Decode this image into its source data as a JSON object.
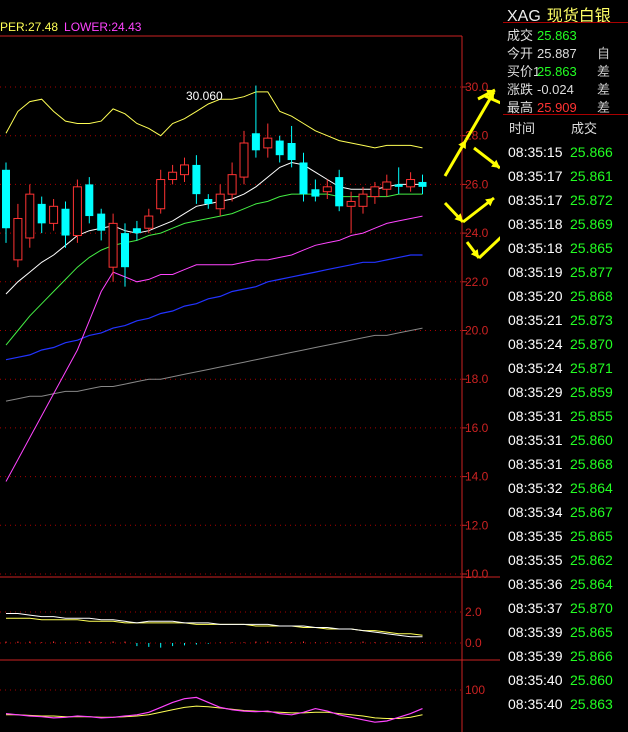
{
  "legend": {
    "upper": "PER:27.48",
    "lower": "LOWER:24.43"
  },
  "peak_label": "30.060",
  "quote": {
    "symbol": "XAG",
    "name": "现货白银",
    "rows": [
      {
        "label": "成交",
        "value": "25.863",
        "color": "#22ff22",
        "extra": ""
      },
      {
        "label": "今开",
        "value": "25.887",
        "color": "#dddddd",
        "extra": "自"
      },
      {
        "label": "买价1",
        "value": "25.863",
        "color": "#22ff22",
        "extra": "差"
      },
      {
        "label": "涨跌",
        "value": "-0.024",
        "color": "#dddddd",
        "extra": "差"
      },
      {
        "label": "最高",
        "value": "25.909",
        "color": "#ff3333",
        "extra": "差"
      }
    ]
  },
  "ticks": {
    "header_time": "时间",
    "header_price": "成交",
    "rows": [
      {
        "time": "08:35:15",
        "price": "25.866"
      },
      {
        "time": "08:35:17",
        "price": "25.861"
      },
      {
        "time": "08:35:17",
        "price": "25.872"
      },
      {
        "time": "08:35:18",
        "price": "25.869"
      },
      {
        "time": "08:35:18",
        "price": "25.865"
      },
      {
        "time": "08:35:19",
        "price": "25.877"
      },
      {
        "time": "08:35:20",
        "price": "25.868"
      },
      {
        "time": "08:35:21",
        "price": "25.873"
      },
      {
        "time": "08:35:24",
        "price": "25.870"
      },
      {
        "time": "08:35:24",
        "price": "25.871"
      },
      {
        "time": "08:35:29",
        "price": "25.859"
      },
      {
        "time": "08:35:31",
        "price": "25.855"
      },
      {
        "time": "08:35:31",
        "price": "25.860"
      },
      {
        "time": "08:35:31",
        "price": "25.868"
      },
      {
        "time": "08:35:32",
        "price": "25.864"
      },
      {
        "time": "08:35:34",
        "price": "25.867"
      },
      {
        "time": "08:35:35",
        "price": "25.865"
      },
      {
        "time": "08:35:35",
        "price": "25.862"
      },
      {
        "time": "08:35:36",
        "price": "25.864"
      },
      {
        "time": "08:35:37",
        "price": "25.870"
      },
      {
        "time": "08:35:39",
        "price": "25.865"
      },
      {
        "time": "08:35:39",
        "price": "25.866"
      },
      {
        "time": "08:35:40",
        "price": "25.860"
      },
      {
        "time": "08:35:40",
        "price": "25.863"
      }
    ]
  },
  "chart_data": {
    "type": "line",
    "price_axis": {
      "labels": [
        "30.0",
        "28.0",
        "26.0",
        "24.0",
        "22.0",
        "20.0",
        "18.0",
        "16.0",
        "14.0",
        "12.0",
        "10.0"
      ],
      "ylim": [
        10,
        30
      ]
    },
    "macd_axis": {
      "labels": [
        "2.0",
        "0.0"
      ]
    },
    "osc_axis": {
      "labels": [
        "100"
      ]
    },
    "colors": {
      "grid": "#aa0000",
      "axis": "#cc2222",
      "up": "#ff3333",
      "down": "#00ffff",
      "boll_upper": "#ffff55",
      "boll_lower": "#ff44ff",
      "mid": "#ffffff",
      "ma_green": "#44ee44",
      "ma_blue": "#2233ff",
      "ma_gray": "#888888",
      "arrow": "#ffff00"
    },
    "candles": [
      {
        "o": 26.6,
        "c": 24.2,
        "h": 26.9,
        "l": 23.6
      },
      {
        "o": 22.9,
        "c": 24.6,
        "h": 25.2,
        "l": 22.6
      },
      {
        "o": 23.8,
        "c": 25.6,
        "h": 26.0,
        "l": 23.4
      },
      {
        "o": 25.2,
        "c": 24.4,
        "h": 25.5,
        "l": 24.0
      },
      {
        "o": 24.4,
        "c": 25.1,
        "h": 25.4,
        "l": 24.1
      },
      {
        "o": 25.0,
        "c": 23.9,
        "h": 25.3,
        "l": 23.4
      },
      {
        "o": 23.9,
        "c": 25.9,
        "h": 26.2,
        "l": 23.6
      },
      {
        "o": 26.0,
        "c": 24.7,
        "h": 26.3,
        "l": 24.4
      },
      {
        "o": 24.8,
        "c": 24.1,
        "h": 25.0,
        "l": 23.7
      },
      {
        "o": 22.6,
        "c": 24.4,
        "h": 24.8,
        "l": 22.0
      },
      {
        "o": 24.0,
        "c": 22.6,
        "h": 24.4,
        "l": 21.8
      },
      {
        "o": 24.2,
        "c": 24.0,
        "h": 24.5,
        "l": 23.7
      },
      {
        "o": 24.2,
        "c": 24.7,
        "h": 25.0,
        "l": 24.0
      },
      {
        "o": 25.0,
        "c": 26.2,
        "h": 26.6,
        "l": 24.8
      },
      {
        "o": 26.2,
        "c": 26.5,
        "h": 26.8,
        "l": 26.0
      },
      {
        "o": 26.4,
        "c": 26.8,
        "h": 27.1,
        "l": 26.1
      },
      {
        "o": 26.8,
        "c": 25.6,
        "h": 27.2,
        "l": 25.2
      },
      {
        "o": 25.4,
        "c": 25.2,
        "h": 25.6,
        "l": 25.0
      },
      {
        "o": 25.0,
        "c": 25.6,
        "h": 26.0,
        "l": 24.7
      },
      {
        "o": 25.6,
        "c": 26.4,
        "h": 26.9,
        "l": 25.3
      },
      {
        "o": 26.3,
        "c": 27.7,
        "h": 28.2,
        "l": 26.0
      },
      {
        "o": 28.1,
        "c": 27.4,
        "h": 30.06,
        "l": 27.1
      },
      {
        "o": 27.5,
        "c": 27.9,
        "h": 28.5,
        "l": 27.1
      },
      {
        "o": 27.8,
        "c": 27.2,
        "h": 28.0,
        "l": 26.9
      },
      {
        "o": 27.7,
        "c": 27.0,
        "h": 28.4,
        "l": 26.7
      },
      {
        "o": 26.9,
        "c": 25.6,
        "h": 27.3,
        "l": 25.3
      },
      {
        "o": 25.8,
        "c": 25.5,
        "h": 26.2,
        "l": 25.3
      },
      {
        "o": 25.7,
        "c": 25.9,
        "h": 26.2,
        "l": 25.4
      },
      {
        "o": 26.3,
        "c": 25.1,
        "h": 26.6,
        "l": 24.9
      },
      {
        "o": 25.1,
        "c": 25.3,
        "h": 25.7,
        "l": 24.0
      },
      {
        "o": 25.1,
        "c": 25.6,
        "h": 25.9,
        "l": 24.8
      },
      {
        "o": 25.5,
        "c": 25.9,
        "h": 26.1,
        "l": 25.2
      },
      {
        "o": 25.8,
        "c": 26.1,
        "h": 26.4,
        "l": 25.5
      },
      {
        "o": 26.0,
        "c": 25.9,
        "h": 26.7,
        "l": 25.6
      },
      {
        "o": 25.9,
        "c": 26.2,
        "h": 26.5,
        "l": 25.7
      },
      {
        "o": 26.1,
        "c": 25.9,
        "h": 26.4,
        "l": 25.6
      }
    ],
    "lines": {
      "boll_upper": [
        28.1,
        29.0,
        29.4,
        29.5,
        29.0,
        28.6,
        28.5,
        28.5,
        28.6,
        29.1,
        28.9,
        28.5,
        28.3,
        28.0,
        28.5,
        28.7,
        29.0,
        29.3,
        29.5,
        29.5,
        29.6,
        29.8,
        29.8,
        29.0,
        28.8,
        28.5,
        28.2,
        28.0,
        27.8,
        27.7,
        27.6,
        27.5,
        27.6,
        27.6,
        27.6,
        27.5
      ],
      "boll_lower": [
        13.8,
        14.7,
        15.6,
        16.5,
        17.4,
        18.3,
        19.2,
        20.4,
        21.6,
        22.4,
        22.2,
        22.0,
        22.1,
        22.3,
        22.3,
        22.5,
        22.7,
        22.7,
        22.7,
        22.7,
        22.8,
        22.9,
        22.9,
        23.0,
        23.1,
        23.3,
        23.5,
        23.6,
        23.7,
        23.9,
        24.0,
        24.2,
        24.4,
        24.5,
        24.6,
        24.7
      ],
      "mid": [
        21.5,
        22.0,
        22.4,
        22.8,
        23.1,
        23.5,
        23.9,
        24.1,
        24.2,
        24.3,
        24.1,
        24.0,
        24.1,
        24.3,
        24.5,
        24.8,
        25.1,
        25.2,
        25.3,
        25.4,
        25.6,
        25.9,
        26.3,
        26.7,
        26.9,
        26.8,
        26.5,
        26.2,
        25.9,
        25.8,
        25.8,
        25.8,
        25.9,
        26.0,
        26.0,
        26.0
      ],
      "ma_green": [
        19.4,
        20.0,
        20.6,
        21.1,
        21.6,
        22.1,
        22.6,
        23.0,
        23.3,
        23.5,
        23.6,
        23.7,
        23.9,
        24.0,
        24.2,
        24.4,
        24.5,
        24.6,
        24.7,
        24.8,
        25.0,
        25.2,
        25.3,
        25.5,
        25.6,
        25.6,
        25.6,
        25.6,
        25.5,
        25.5,
        25.5,
        25.5,
        25.5,
        25.6,
        25.6,
        25.6
      ],
      "ma_blue": [
        18.8,
        18.9,
        19.0,
        19.2,
        19.3,
        19.5,
        19.6,
        19.8,
        19.9,
        20.1,
        20.2,
        20.4,
        20.5,
        20.7,
        20.8,
        21.0,
        21.1,
        21.3,
        21.4,
        21.6,
        21.7,
        21.8,
        22.0,
        22.1,
        22.2,
        22.3,
        22.4,
        22.5,
        22.6,
        22.7,
        22.8,
        22.8,
        22.9,
        23.0,
        23.1,
        23.1
      ],
      "ma_gray": [
        17.1,
        17.2,
        17.3,
        17.3,
        17.4,
        17.5,
        17.5,
        17.6,
        17.7,
        17.7,
        17.8,
        17.9,
        18.0,
        18.0,
        18.1,
        18.2,
        18.3,
        18.4,
        18.5,
        18.6,
        18.7,
        18.8,
        18.9,
        19.0,
        19.1,
        19.2,
        19.3,
        19.4,
        19.5,
        19.6,
        19.7,
        19.8,
        19.8,
        19.9,
        20.0,
        20.1
      ]
    },
    "macd": {
      "dif": [
        1.9,
        1.9,
        1.8,
        1.7,
        1.7,
        1.6,
        1.6,
        1.6,
        1.5,
        1.5,
        1.4,
        1.3,
        1.4,
        1.4,
        1.4,
        1.3,
        1.3,
        1.3,
        1.2,
        1.2,
        1.2,
        1.2,
        1.2,
        1.1,
        1.1,
        1.1,
        1.0,
        1.0,
        0.9,
        0.9,
        0.8,
        0.7,
        0.6,
        0.5,
        0.4,
        0.4
      ],
      "dea": [
        1.6,
        1.6,
        1.6,
        1.5,
        1.5,
        1.5,
        1.5,
        1.4,
        1.4,
        1.4,
        1.3,
        1.3,
        1.3,
        1.3,
        1.3,
        1.3,
        1.2,
        1.2,
        1.2,
        1.2,
        1.2,
        1.1,
        1.1,
        1.1,
        1.1,
        1.0,
        1.0,
        0.9,
        0.9,
        0.9,
        0.8,
        0.8,
        0.7,
        0.6,
        0.6,
        0.5
      ],
      "hist": [
        0.1,
        0.1,
        0.1,
        0.05,
        0.1,
        0.05,
        0.05,
        0.1,
        0.05,
        0.1,
        0.1,
        -0.2,
        -0.25,
        -0.3,
        -0.2,
        -0.15,
        -0.1,
        -0.05,
        0.05,
        0.05,
        0.05,
        0.1,
        0.1,
        0.05,
        0.05,
        0.1,
        0.05,
        0.05,
        0.05,
        0.05,
        0.1,
        0.05,
        0.05,
        0.05,
        0.05,
        0.05
      ]
    },
    "osc": {
      "a": [
        62,
        60,
        58,
        57,
        55,
        56,
        58,
        57,
        55,
        56,
        58,
        60,
        64,
        72,
        80,
        86,
        88,
        80,
        72,
        68,
        66,
        65,
        66,
        62,
        60,
        64,
        70,
        66,
        60,
        56,
        52,
        48,
        50,
        56,
        62,
        70
      ],
      "b": [
        60,
        60,
        59,
        58,
        58,
        57,
        57,
        57,
        56,
        56,
        57,
        58,
        60,
        64,
        68,
        72,
        74,
        73,
        71,
        69,
        67,
        66,
        65,
        64,
        63,
        63,
        64,
        64,
        62,
        60,
        58,
        55,
        54,
        54,
        56,
        60
      ]
    }
  }
}
